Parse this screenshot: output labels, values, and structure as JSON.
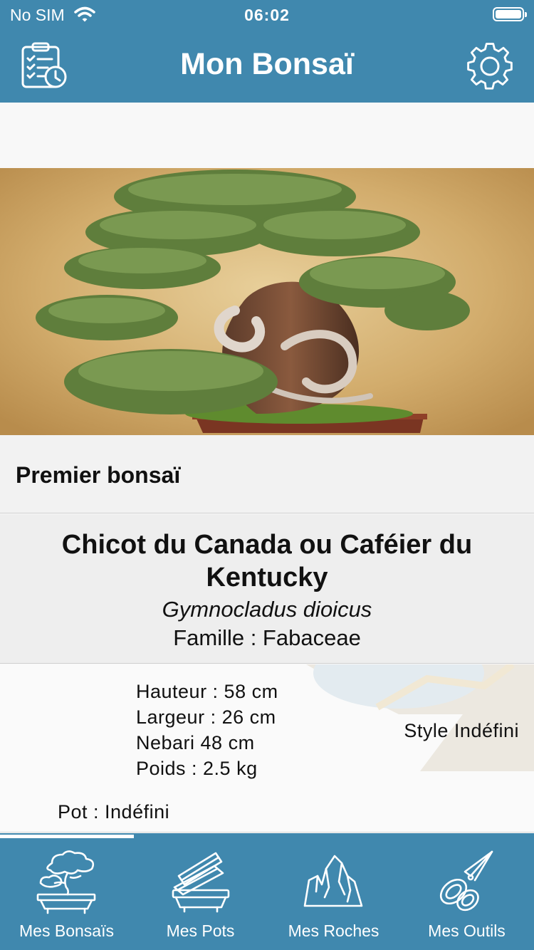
{
  "status_bar": {
    "carrier": "No SIM",
    "time": "06:02"
  },
  "header": {
    "title": "Mon Bonsaï",
    "left_icon": "clipboard-checklist-icon",
    "right_icon": "gear-icon"
  },
  "bonsai": {
    "name": "Premier bonsaï",
    "species_common": "Chicot du Canada ou Caféier du Kentucky",
    "species_latin": "Gymnocladus dioicus",
    "family": "Famille :  Fabaceae",
    "height": "Hauteur :  58  cm",
    "width": "Largeur :  26  cm",
    "nebari": "Nebari  48  cm",
    "weight": "Poids :  2.5  kg",
    "style": "Style  Indéfini",
    "pot": "Pot :  Indéfini"
  },
  "tabs": [
    {
      "label": "Mes Bonsaïs",
      "icon": "bonsai-tree-icon",
      "selected": true
    },
    {
      "label": "Mes Pots",
      "icon": "pot-stack-icon",
      "selected": false
    },
    {
      "label": "Mes Roches",
      "icon": "rocks-icon",
      "selected": false
    },
    {
      "label": "Mes Outils",
      "icon": "pruning-shears-icon",
      "selected": false
    }
  ],
  "colors": {
    "accent": "#4088ae",
    "background": "#f8f8f8"
  }
}
